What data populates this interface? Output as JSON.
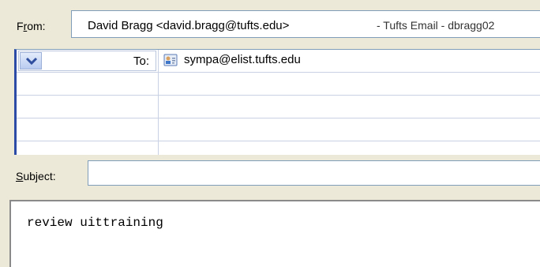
{
  "header": {
    "from_label_pre": "F",
    "from_label_key": "r",
    "from_label_post": "om:",
    "from_sender": "David Bragg <david.bragg@tufts.edu>",
    "from_account": "- Tufts Email - dbragg02",
    "to_label": "To:",
    "recipients": [
      "sympa@elist.tufts.edu"
    ],
    "subject_label_key": "S",
    "subject_label_post": "ubject:",
    "subject_value": ""
  },
  "body": {
    "text": "review uittraining"
  },
  "icons": {
    "dropdown": "chevron-down-icon",
    "contact": "contact-card-icon"
  },
  "colors": {
    "background": "#ECE9D8",
    "field_border": "#7F9DB9",
    "grid_line": "#C9D2E5",
    "accent": "#2B4BA6"
  }
}
